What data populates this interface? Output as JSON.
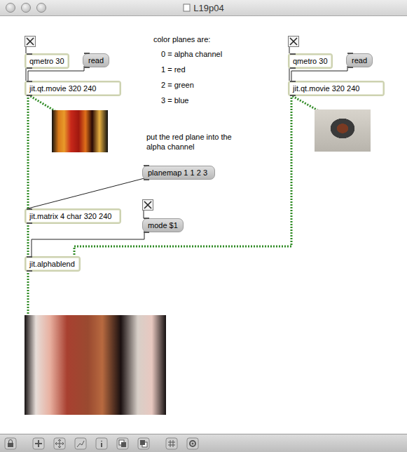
{
  "window": {
    "title": "L19p04"
  },
  "boxes": [
    {
      "kind": "toggle",
      "checked": true
    },
    {
      "kind": "object",
      "text": "qmetro 30"
    },
    {
      "kind": "message",
      "text": "read"
    },
    {
      "kind": "object",
      "text": "jit.qt.movie 320 240"
    },
    {
      "kind": "toggle",
      "checked": true
    },
    {
      "kind": "object",
      "text": "qmetro 30"
    },
    {
      "kind": "message",
      "text": "read"
    },
    {
      "kind": "object",
      "text": "jit.qt.movie 320 240"
    },
    {
      "kind": "message",
      "text": "planemap 1 1 2 3"
    },
    {
      "kind": "object",
      "text": "jit.matrix 4 char 320 240"
    },
    {
      "kind": "toggle",
      "checked": true
    },
    {
      "kind": "message",
      "text": "mode $1"
    },
    {
      "kind": "object",
      "text": "jit.alphablend"
    }
  ],
  "comments": [
    {
      "lines": [
        "color planes are:"
      ]
    },
    {
      "lines": [
        "0 = alpha channel"
      ]
    },
    {
      "lines": [
        "1 = red"
      ]
    },
    {
      "lines": [
        "2 = green"
      ]
    },
    {
      "lines": [
        "3 = blue"
      ]
    },
    {
      "lines": [
        "put the red plane into the",
        "alpha channel"
      ]
    }
  ]
}
